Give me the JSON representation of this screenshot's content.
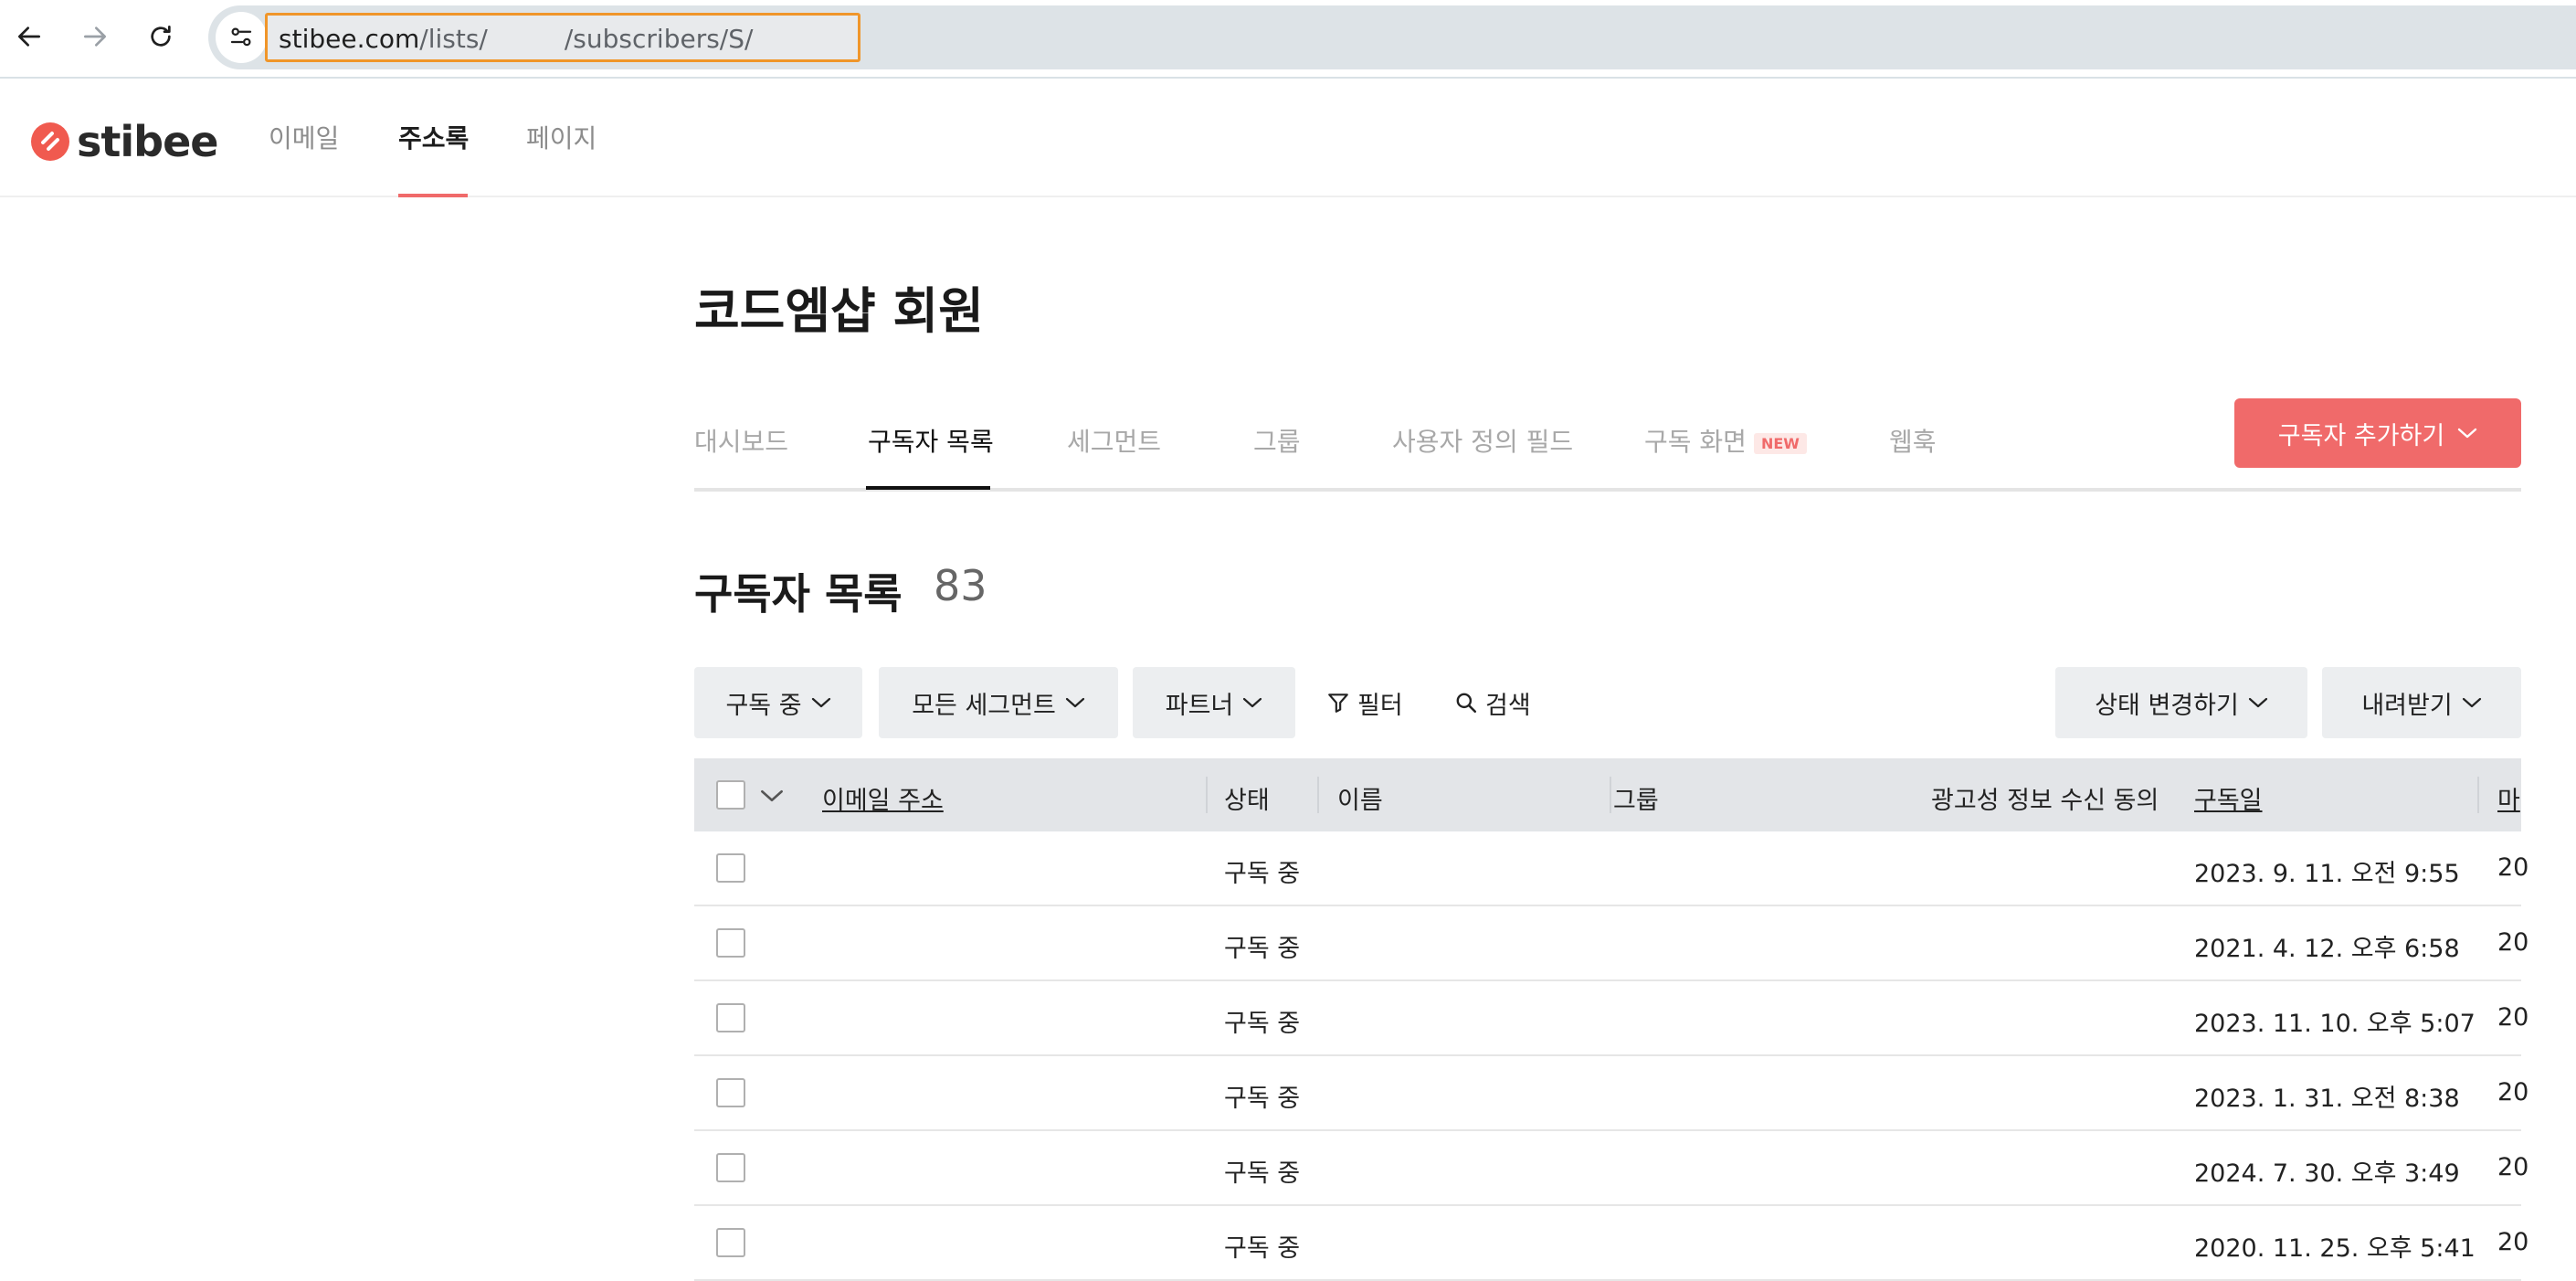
{
  "browser": {
    "url_host": "stibee.com",
    "url_part1": "/lists/",
    "url_part2": "/subscribers/S/"
  },
  "app": {
    "logo_text": "stibee",
    "nav": [
      {
        "label": "이메일",
        "active": false
      },
      {
        "label": "주소록",
        "active": true
      },
      {
        "label": "페이지",
        "active": false
      }
    ]
  },
  "page": {
    "title": "코드엠샵 회원",
    "tabs": [
      {
        "label": "대시보드",
        "active": false
      },
      {
        "label": "구독자 목록",
        "active": true
      },
      {
        "label": "세그먼트",
        "active": false
      },
      {
        "label": "그룹",
        "active": false
      },
      {
        "label": "사용자 정의 필드",
        "active": false
      },
      {
        "label": "구독 화면",
        "active": false,
        "badge": "NEW"
      },
      {
        "label": "웹훅",
        "active": false
      }
    ],
    "add_button_label": "구독자 추가하기"
  },
  "list": {
    "title": "구독자 목록",
    "count": "83",
    "toolbar": {
      "status_filter": "구독 중",
      "segment_filter": "모든 세그먼트",
      "partner_filter": "파트너",
      "filter_label": "필터",
      "search_label": "검색",
      "change_status": "상태 변경하기",
      "download": "내려받기"
    },
    "columns": {
      "email": "이메일 주소",
      "status": "상태",
      "name": "이름",
      "group": "그룹",
      "ad_consent": "광고성 정보 수신 동의",
      "subscribed_at": "구독일",
      "last": "마"
    },
    "rows": [
      {
        "status": "구독 중",
        "subscribed_at": "2023. 9. 11. 오전 9:55",
        "last": "20"
      },
      {
        "status": "구독 중",
        "subscribed_at": "2021. 4. 12. 오후 6:58",
        "last": "20"
      },
      {
        "status": "구독 중",
        "subscribed_at": "2023. 11. 10. 오후 5:07",
        "last": "20"
      },
      {
        "status": "구독 중",
        "subscribed_at": "2023. 1. 31. 오전 8:38",
        "last": "20"
      },
      {
        "status": "구독 중",
        "subscribed_at": "2024. 7. 30. 오후 3:49",
        "last": "20"
      },
      {
        "status": "구독 중",
        "subscribed_at": "2020. 11. 25. 오후 5:41",
        "last": "20"
      }
    ]
  },
  "colors": {
    "accent": "#f06a6a",
    "highlight_border": "#f0962a"
  }
}
